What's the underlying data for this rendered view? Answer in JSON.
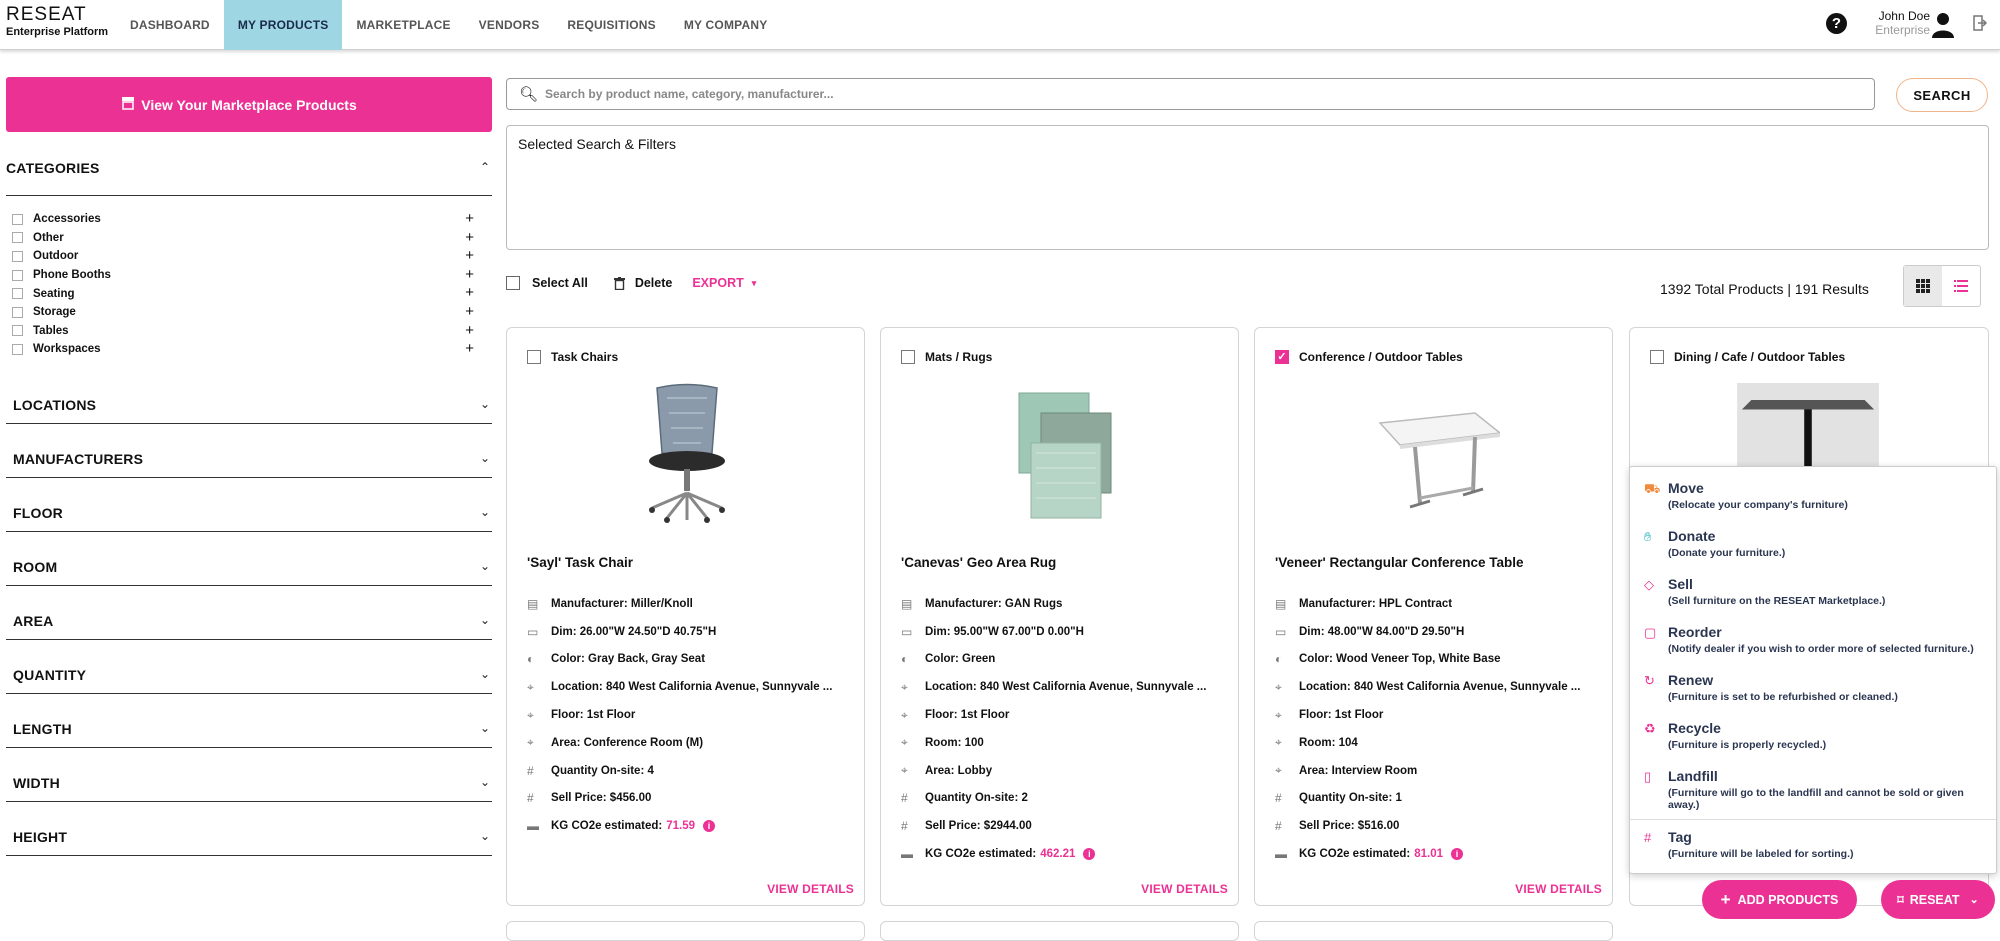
{
  "header": {
    "brand": "RESEAT",
    "brand_sub": "Enterprise Platform",
    "nav": [
      {
        "label": "DASHBOARD",
        "active": false
      },
      {
        "label": "MY PRODUCTS",
        "active": true
      },
      {
        "label": "MARKETPLACE",
        "active": false
      },
      {
        "label": "VENDORS",
        "active": false
      },
      {
        "label": "REQUISITIONS",
        "active": false
      },
      {
        "label": "MY COMPANY",
        "active": false
      }
    ],
    "help_icon": "?",
    "user_name": "John Doe",
    "user_role": "Enterprise"
  },
  "sidebar": {
    "marketplace_button": "View Your Marketplace Products",
    "categories_title": "CATEGORIES",
    "categories": [
      "Accessories",
      "Other",
      "Outdoor",
      "Phone Booths",
      "Seating",
      "Storage",
      "Tables",
      "Workspaces"
    ],
    "sections": [
      "LOCATIONS",
      "MANUFACTURERS",
      "FLOOR",
      "ROOM",
      "AREA",
      "QUANTITY",
      "LENGTH",
      "WIDTH",
      "HEIGHT"
    ]
  },
  "search": {
    "placeholder": "Search by product name, category, manufacturer...",
    "button": "SEARCH",
    "filters_title": "Selected Search & Filters"
  },
  "toolbar": {
    "select_all": "Select All",
    "delete": "Delete",
    "export": "EXPORT",
    "totals": "1392 Total Products | 191 Results"
  },
  "cards": [
    {
      "category": "Task Chairs",
      "checked": false,
      "name": "'Sayl' Task Chair",
      "manufacturer": "Manufacturer: Miller/Knoll",
      "dim": "Dim: 26.00\"W 24.50\"D 40.75\"H",
      "color": "Color: Gray Back, Gray Seat",
      "location": "Location: 840 West California Avenue, Sunnyvale ...",
      "floor": "Floor: 1st Floor",
      "extra1": "Area: Conference Room (M)",
      "extra2": "",
      "quantity": "Quantity On-site: 4",
      "price": "Sell Price: $456.00",
      "co2_label": "KG CO2e estimated:",
      "co2_value": "71.59",
      "details": "VIEW DETAILS"
    },
    {
      "category": "Mats / Rugs",
      "checked": false,
      "name": "'Canevas' Geo Area Rug",
      "manufacturer": "Manufacturer: GAN Rugs",
      "dim": "Dim: 95.00\"W 67.00\"D 0.00\"H",
      "color": "Color: Green",
      "location": "Location: 840 West California Avenue, Sunnyvale ...",
      "floor": "Floor: 1st Floor",
      "extra1": "Room: 100",
      "extra2": "Area: Lobby",
      "quantity": "Quantity On-site: 2",
      "price": "Sell Price: $2944.00",
      "co2_label": "KG CO2e estimated:",
      "co2_value": "462.21",
      "details": "VIEW DETAILS"
    },
    {
      "category": "Conference / Outdoor Tables",
      "checked": true,
      "name": "'Veneer' Rectangular Conference Table",
      "manufacturer": "Manufacturer: HPL Contract",
      "dim": "Dim: 48.00\"W 84.00\"D 29.50\"H",
      "color": "Color: Wood Veneer Top, White Base",
      "location": "Location: 840 West California Avenue, Sunnyvale ...",
      "floor": "Floor: 1st Floor",
      "extra1": "Room: 104",
      "extra2": "Area: Interview Room",
      "quantity": "Quantity On-site: 1",
      "price": "Sell Price: $516.00",
      "co2_label": "KG CO2e estimated:",
      "co2_value": "81.01",
      "details": "VIEW DETAILS"
    },
    {
      "category": "Dining / Cafe / Outdoor Tables",
      "checked": false
    }
  ],
  "action_menu": [
    {
      "label": "Move",
      "desc": "(Relocate your company's furniture)",
      "icon": "truck-icon",
      "color": "#f08a3c"
    },
    {
      "label": "Donate",
      "desc": "(Donate your furniture.)",
      "icon": "donate-hand-icon",
      "color": "#2bb3c0"
    },
    {
      "label": "Sell",
      "desc": "(Sell furniture on the RESEAT Marketplace.)",
      "icon": "price-tag-icon",
      "color": "#ec3194"
    },
    {
      "label": "Reorder",
      "desc": "(Notify dealer if you wish to order more of selected furniture.)",
      "icon": "shopping-bag-icon",
      "color": "#ec3194"
    },
    {
      "label": "Renew",
      "desc": "(Furniture is set to be refurbished or cleaned.)",
      "icon": "refresh-icon",
      "color": "#ec3194"
    },
    {
      "label": "Recycle",
      "desc": "(Furniture is properly recycled.)",
      "icon": "recycle-icon",
      "color": "#ec3194"
    },
    {
      "label": "Landfill",
      "desc": "(Furniture will go to the landfill and cannot be sold or given away.)",
      "icon": "trash-icon",
      "color": "#ec3194"
    },
    {
      "label": "Tag",
      "desc": "(Furniture will be labeled for sorting.)",
      "icon": "hash-icon",
      "color": "#ec3194"
    }
  ],
  "fab": {
    "add_products": "ADD PRODUCTS",
    "reseat": "RESEAT"
  },
  "colors": {
    "accent": "#ec3194",
    "nav_active": "#9fd6e3"
  }
}
